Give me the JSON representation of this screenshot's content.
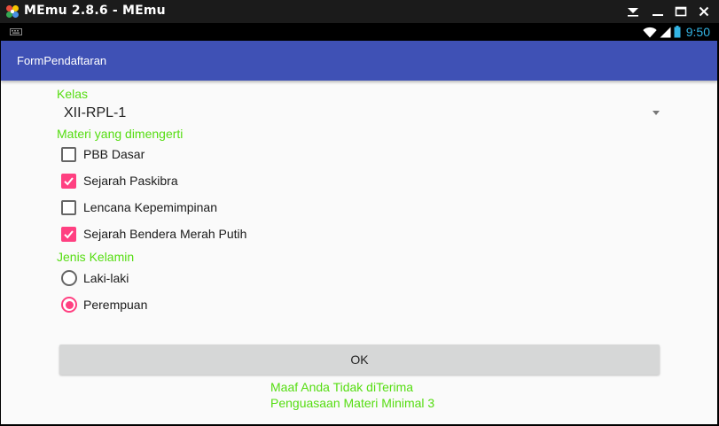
{
  "window": {
    "title": "MEmu 2.8.6 - MEmu",
    "controls": [
      {
        "name": "menu-dropdown-icon"
      },
      {
        "name": "minimize-icon"
      },
      {
        "name": "maximize-icon"
      },
      {
        "name": "close-icon"
      }
    ]
  },
  "status_bar": {
    "time": "9:50",
    "icons": [
      "keyboard-notification-icon",
      "wifi-icon",
      "signal-icon",
      "battery-icon"
    ]
  },
  "app": {
    "title": "FormPendaftaran"
  },
  "form": {
    "kelas_label": "Kelas",
    "kelas_value": "XII-RPL-1",
    "materi_label": "Materi yang dimengerti",
    "materi_options": [
      {
        "label": "PBB Dasar",
        "checked": false
      },
      {
        "label": "Sejarah Paskibra",
        "checked": true
      },
      {
        "label": "Lencana Kepemimpinan",
        "checked": false
      },
      {
        "label": "Sejarah Bendera Merah Putih",
        "checked": true
      }
    ],
    "gender_label": "Jenis Kelamin",
    "gender_options": [
      {
        "label": "Laki-laki",
        "selected": false
      },
      {
        "label": "Perempuan",
        "selected": true
      }
    ],
    "ok_label": "OK"
  },
  "result": {
    "line1": "Maaf Anda Tidak diTerima",
    "line2": "Penguasaan Materi Minimal 3"
  },
  "colors": {
    "action_bar": "#3f51b5",
    "accent": "#ff4081",
    "label_green": "#55dd11",
    "status_blue": "#33b5e5"
  }
}
